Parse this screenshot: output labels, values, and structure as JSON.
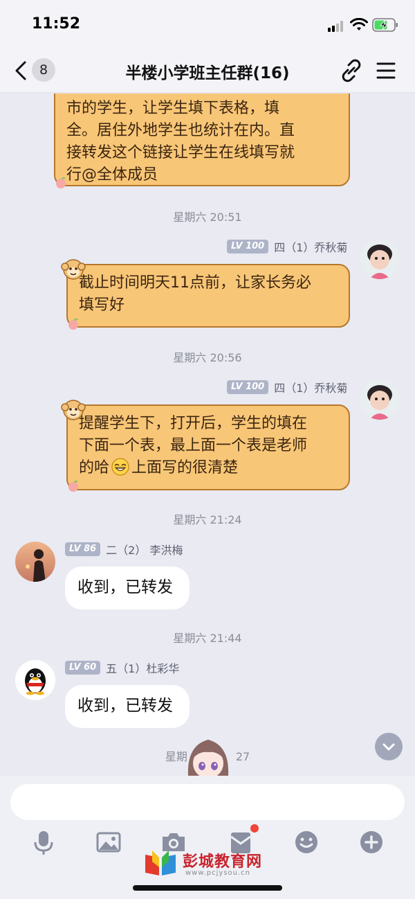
{
  "status_bar": {
    "time": "11:52"
  },
  "nav": {
    "back_count": "8",
    "title": "半楼小学班主任群(16)"
  },
  "messages": [
    {
      "type": "incoming_orange_partial",
      "lines": [
        "市的学生，让学生填下表格，填",
        "全。居住外地学生也统计在内。直",
        "接转发这个链接让学生在线填写就",
        "行@全体成员"
      ]
    },
    {
      "type": "time",
      "text": "星期六 20:51"
    },
    {
      "type": "orange",
      "level": "LV 100",
      "sender": "四（1）乔秋菊",
      "lines": [
        "截止时间明天11点前，让家长务必",
        "填写好"
      ]
    },
    {
      "type": "time",
      "text": "星期六 20:56"
    },
    {
      "type": "orange",
      "level": "LV 100",
      "sender": "四（1）乔秋菊",
      "lines": [
        "提醒学生下，打开后，学生的填在",
        "下面一个表，最上面一个表是老师",
        "的哈",
        "上面写的很清楚"
      ]
    },
    {
      "type": "time",
      "text": "星期六 21:24"
    },
    {
      "type": "white",
      "level": "LV 86",
      "sender": "二（2） 李洪梅",
      "text": "收到，已转发"
    },
    {
      "type": "time",
      "text": "星期六 21:44"
    },
    {
      "type": "white",
      "level": "LV 60",
      "sender": "五（1）杜彩华",
      "text": "收到，已转发"
    },
    {
      "type": "time_partial",
      "left": "星期",
      "right": "27"
    }
  ],
  "input": {
    "placeholder": ""
  },
  "toolbar_icons": [
    "microphone-icon",
    "image-icon",
    "camera-icon",
    "red-packet-icon",
    "emoji-icon",
    "plus-icon"
  ],
  "watermark": {
    "title": "彭城教育网",
    "sub": "www.pcjysou.cn"
  },
  "colors": {
    "orange_bubble": "#f8c677",
    "orange_border": "#b5772b",
    "background": "#e9eaf2",
    "level_badge": "#aeb4c8"
  }
}
